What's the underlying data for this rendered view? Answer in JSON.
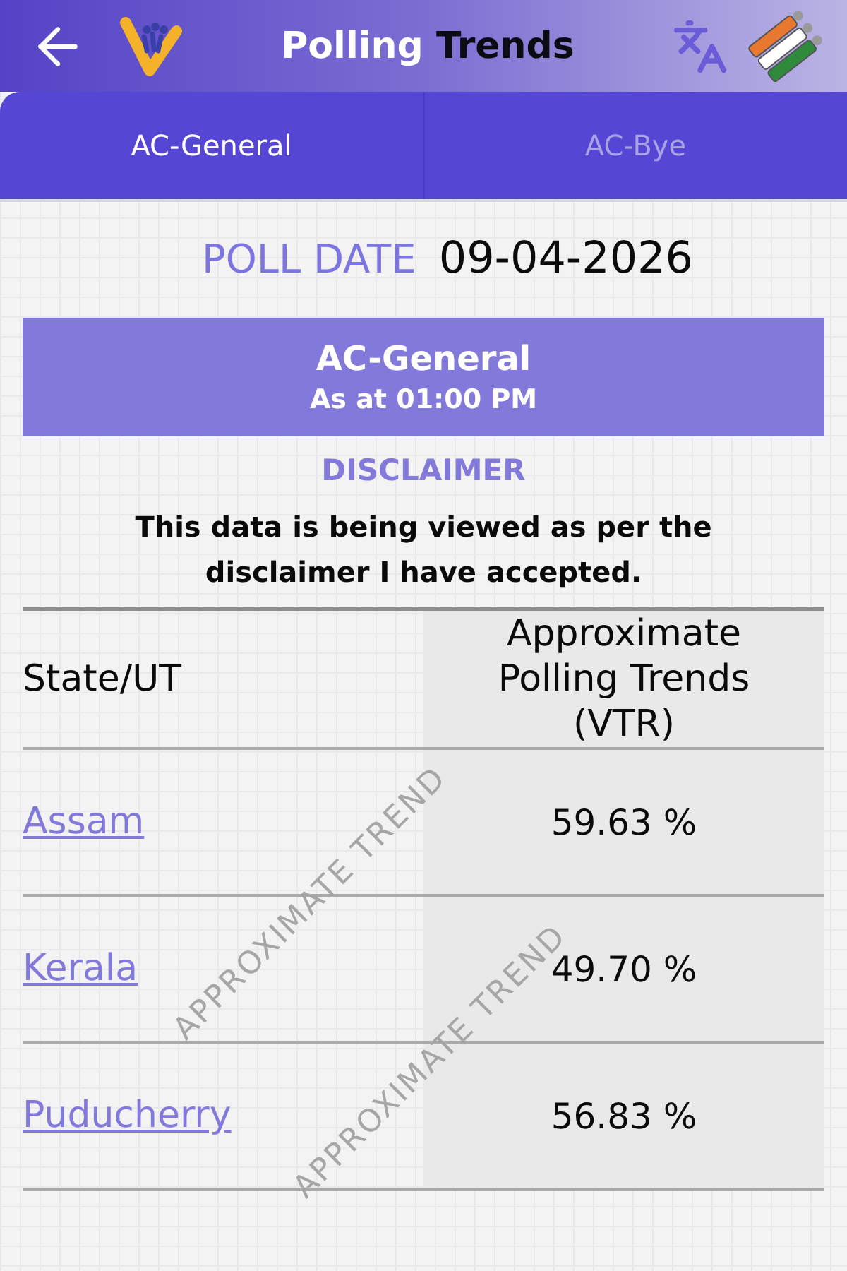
{
  "header": {
    "title": {
      "lead": "Polling",
      "accent": "Trends"
    }
  },
  "tabs": [
    {
      "label": "AC-General",
      "selected": true
    },
    {
      "label": "AC-Bye",
      "selected": false
    }
  ],
  "poll_date": {
    "label": "POLL DATE",
    "value": "09-04-2026"
  },
  "banner": {
    "title": "AC-General",
    "time": "As at 01:00 PM"
  },
  "disclaimer": {
    "heading": "DISCLAIMER",
    "text": "This data is being viewed as per the disclaimer I have accepted."
  },
  "table": {
    "columns": [
      "State/UT",
      "Approximate Polling Trends (VTR)"
    ],
    "rows": [
      {
        "state": "Assam",
        "value": "59.63 %"
      },
      {
        "state": "Kerala",
        "value": "49.70 %"
      },
      {
        "state": "Puducherry",
        "value": "56.83 %"
      }
    ]
  },
  "watermarks": [
    "APPROXIMATE TREND",
    "APPROXIMATE TREND"
  ]
}
